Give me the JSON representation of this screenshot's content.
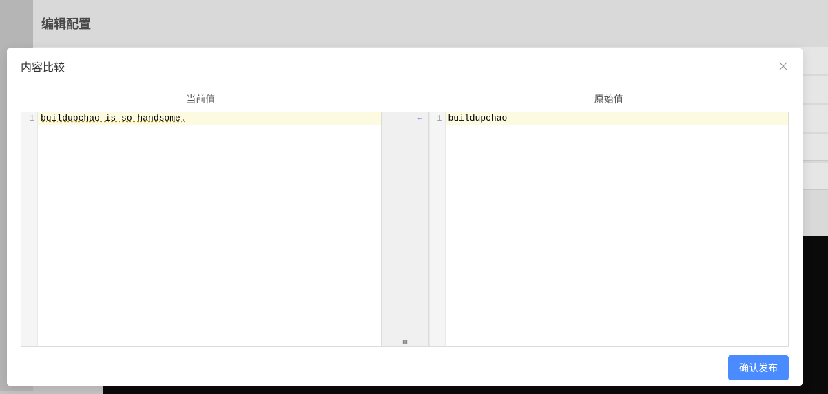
{
  "page": {
    "title": "编辑配置"
  },
  "modal": {
    "title": "内容比较",
    "columns": {
      "current": "当前值",
      "original": "原始值"
    },
    "diff": {
      "left": {
        "lines": [
          {
            "num": 1,
            "text": "buildupchao is so handsome.",
            "changed": true
          }
        ]
      },
      "right": {
        "lines": [
          {
            "num": 1,
            "text": "buildupchao",
            "changed": true
          }
        ]
      }
    },
    "footer": {
      "confirm": "确认发布"
    }
  }
}
